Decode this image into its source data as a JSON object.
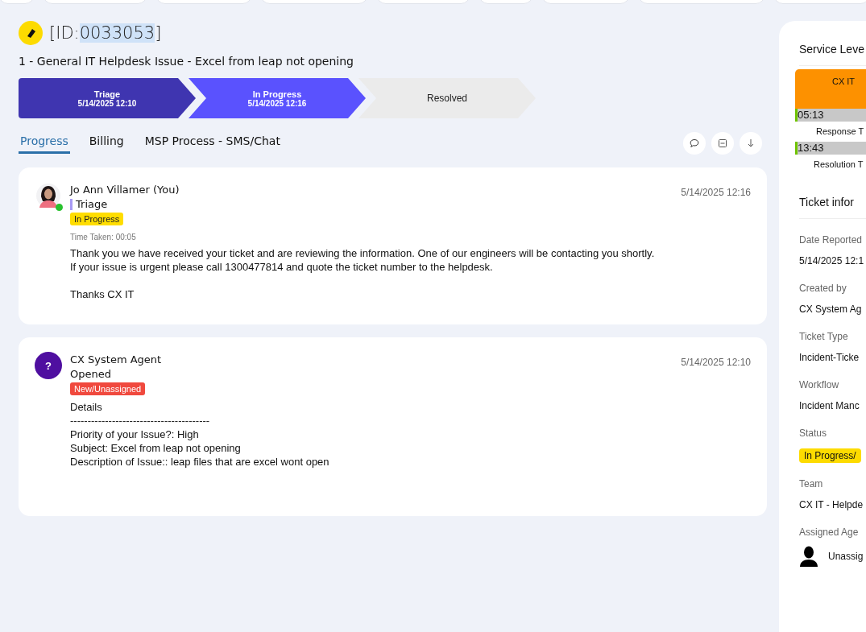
{
  "ticket": {
    "id_prefix": "[ID:",
    "id": "0033053",
    "id_suffix": "]",
    "title": "1 - General IT Helpdesk Issue - Excel from leap not opening"
  },
  "steps": [
    {
      "label": "Triage",
      "date": "5/14/2025 12:10",
      "completed": true,
      "current": false
    },
    {
      "label": "In Progress",
      "date": "5/14/2025 12:16",
      "completed": false,
      "current": true
    },
    {
      "label": "Resolved",
      "completed": false,
      "current": false
    }
  ],
  "tabs": [
    {
      "label": "Progress",
      "selected": true
    },
    {
      "label": "Billing",
      "selected": false
    },
    {
      "label": "MSP Process - SMS/Chat",
      "selected": false
    }
  ],
  "entries": [
    {
      "author": "Jo Ann Villamer (You)",
      "online": true,
      "stage": "Triage",
      "stage_bar": true,
      "status": "In Progress",
      "color": "#ffdd00",
      "time": "5/14/2025 12:16",
      "time_taken": "Time Taken: 00:05",
      "paragraphs": [
        [
          "Thank you we have received your ticket and are reviewing the information. One of our engineers will be contacting you shortly.",
          "If your issue is urgent please call 1300477814 and quote the ticket number to the helpdesk."
        ],
        [
          "Thanks CX IT"
        ]
      ]
    },
    {
      "kind": "system",
      "avatar_text": "?",
      "author": "CX System Agent",
      "online": false,
      "stage": "Opened",
      "status": "New/Unassigned",
      "color": "#f0493e",
      "time": "5/14/2025 12:10",
      "paragraphs": [
        [
          "Details",
          "----------------------------------------",
          "Priority of your Issue?: High",
          "Subject: Excel from leap not opening",
          "Description of Issue:: leap files that are excel wont open"
        ]
      ]
    }
  ],
  "side": {
    "sla_title": "Service Leve",
    "sla_team": "CX IT",
    "timers": [
      {
        "value": "05:13",
        "caption": "Response T"
      },
      {
        "value": "13:43",
        "caption": "Resolution T"
      }
    ],
    "info_title": "Ticket infor",
    "fields": [
      {
        "kind": "text",
        "label": "Date Reported",
        "value": "5/14/2025 12:1"
      },
      {
        "kind": "text",
        "label": "Created by",
        "value": "CX System Ag"
      },
      {
        "kind": "text",
        "label": "Ticket Type",
        "value": "Incident-Ticke"
      },
      {
        "kind": "text",
        "label": "Workflow",
        "value": "Incident Manc"
      },
      {
        "kind": "badge",
        "label": "Status",
        "value": "In Progress/"
      },
      {
        "kind": "text",
        "label": "Team",
        "value": "CX IT - Helpde"
      },
      {
        "kind": "person",
        "label": "Assigned Age",
        "value": "Unassig"
      }
    ]
  }
}
